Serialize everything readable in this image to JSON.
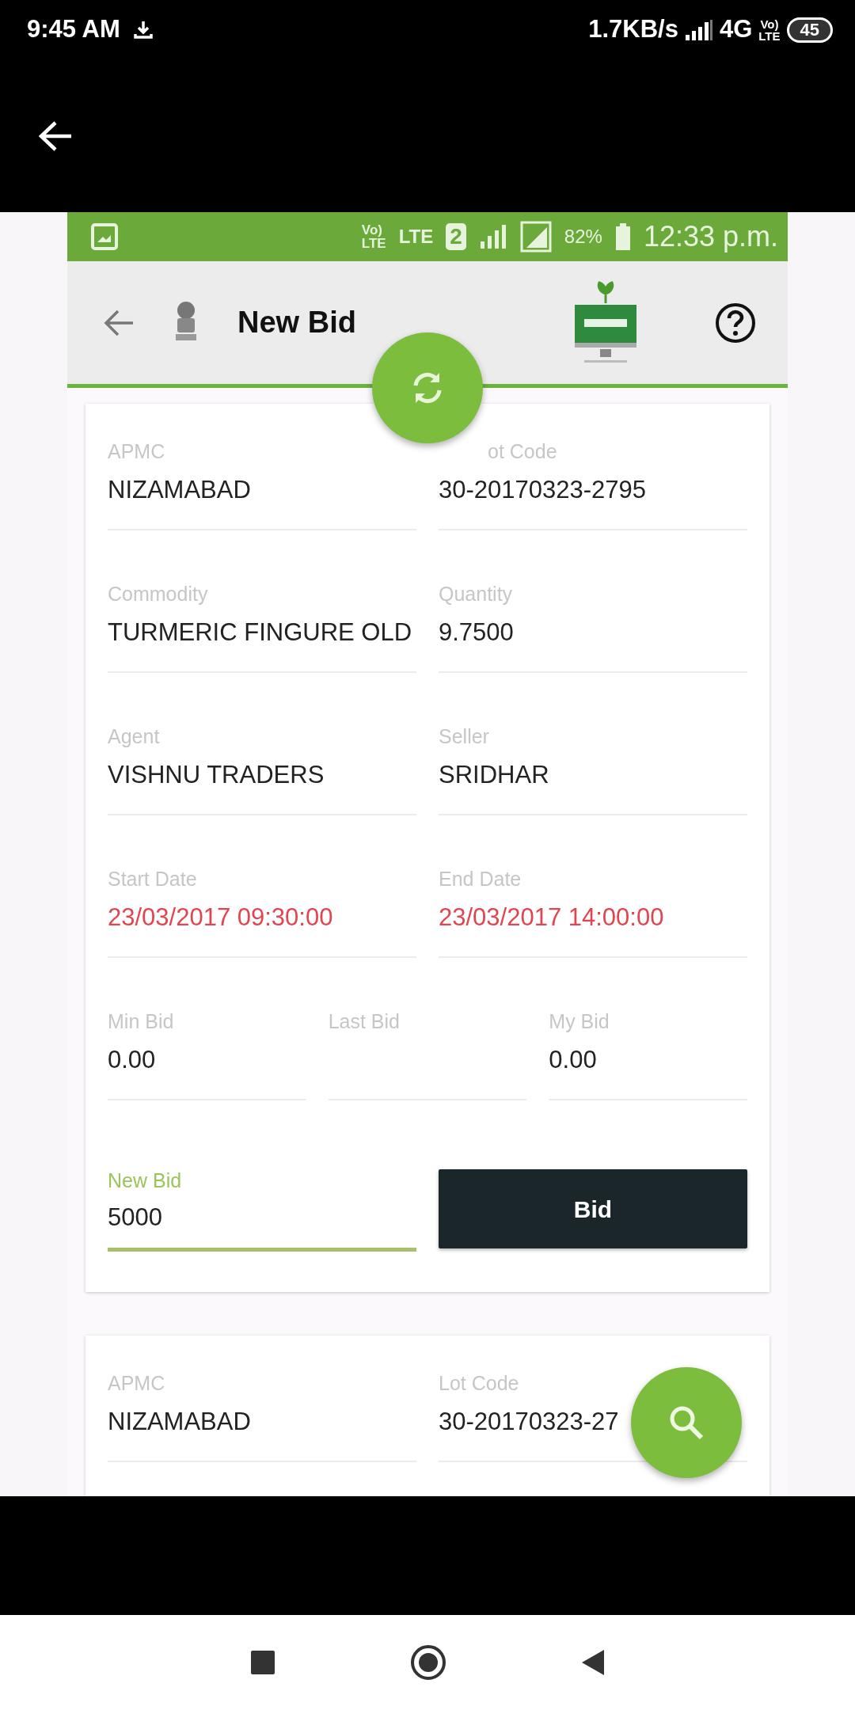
{
  "status_bar": {
    "time": "9:45 AM",
    "net_speed": "1.7KB/s",
    "network": "4G",
    "volte": [
      "Vo)",
      "LTE"
    ],
    "battery": "45"
  },
  "inner_status_bar": {
    "volte": [
      "Vo)",
      "LTE"
    ],
    "lte": "LTE",
    "sim": "2",
    "battery": "82%",
    "time": "12:33 p.m."
  },
  "app_bar": {
    "title": "New Bid"
  },
  "cards": [
    {
      "fields": [
        {
          "label": "APMC",
          "value": "NIZAMABAD",
          "color": "#222222"
        },
        {
          "label": "ot Code",
          "value": "30-20170323-2795",
          "color": "#222222"
        },
        {
          "label": "Commodity",
          "value": "TURMERIC FINGURE OLD",
          "color": "#222222"
        },
        {
          "label": "Quantity",
          "value": "9.7500",
          "color": "#222222"
        },
        {
          "label": "Agent",
          "value": "VISHNU TRADERS",
          "color": "#222222"
        },
        {
          "label": "Seller",
          "value": "SRIDHAR",
          "color": "#222222"
        },
        {
          "label": "Start Date",
          "value": "23/03/2017 09:30:00",
          "color": "#e04550"
        },
        {
          "label": "End Date",
          "value": "23/03/2017 14:00:00",
          "color": "#e04550"
        }
      ],
      "bids": [
        {
          "label": "Min Bid",
          "value": "0.00"
        },
        {
          "label": "Last Bid"
        },
        {
          "label": "My Bid",
          "value": "0.00"
        }
      ],
      "new_bid": {
        "label": "New Bid",
        "value": "5000",
        "focused": true
      },
      "button": "Bid"
    },
    {
      "fields": [
        {
          "label": "APMC",
          "value": "NIZAMABAD",
          "color": "#222222"
        },
        {
          "label": "Lot Code",
          "value": "30-20170323-27",
          "color": "#222222"
        }
      ]
    }
  ]
}
